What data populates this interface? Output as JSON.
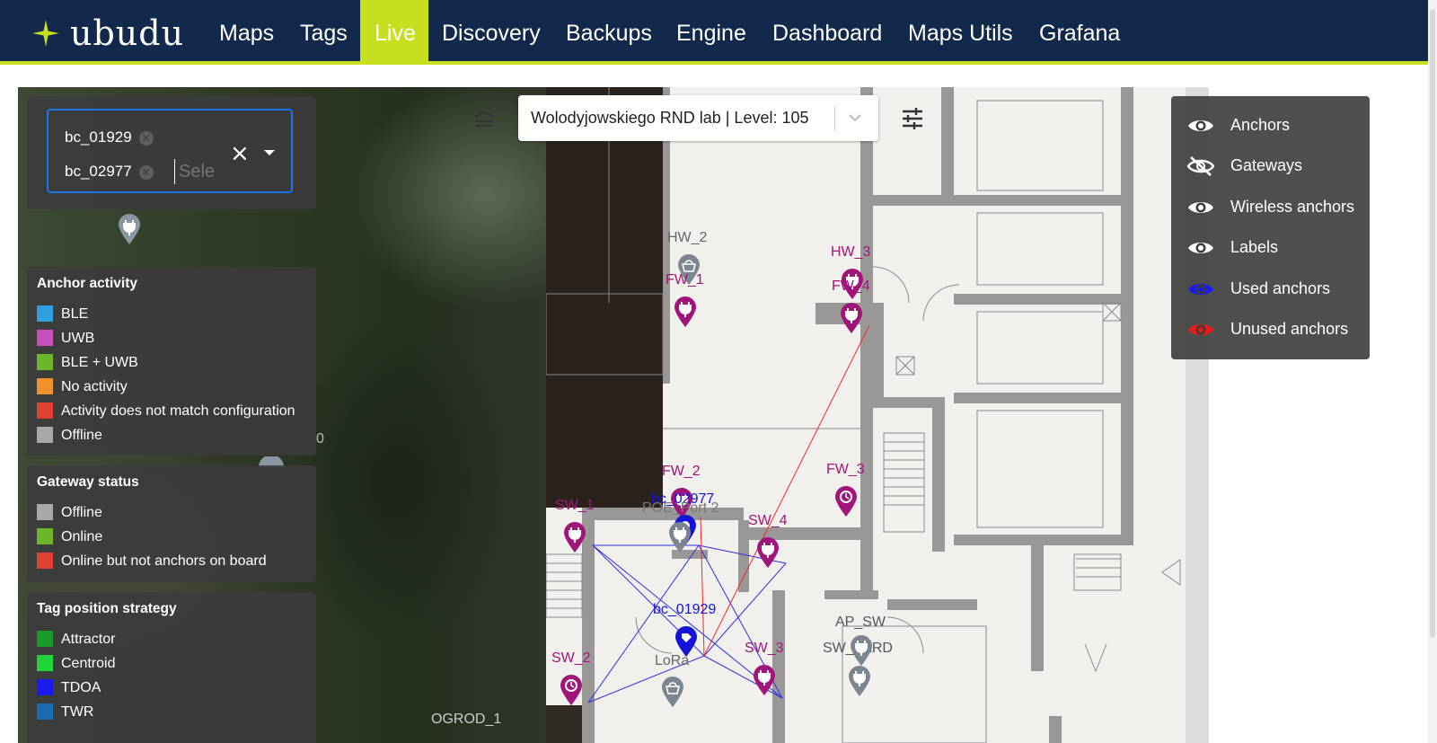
{
  "nav": {
    "brand": "ubudu",
    "items": [
      {
        "label": "Maps",
        "active": false
      },
      {
        "label": "Tags",
        "active": false
      },
      {
        "label": "Live",
        "active": true
      },
      {
        "label": "Discovery",
        "active": false
      },
      {
        "label": "Backups",
        "active": false
      },
      {
        "label": "Engine",
        "active": false
      },
      {
        "label": "Dashboard",
        "active": false
      },
      {
        "label": "Maps Utils",
        "active": false
      },
      {
        "label": "Grafana",
        "active": false
      }
    ],
    "accent": "#c6df1f",
    "background": "#13294b"
  },
  "tag_select": {
    "chips": [
      "bc_01929",
      "bc_02977"
    ],
    "placeholder": "Sele"
  },
  "level_select": {
    "label": "Wolodyjowskiego RND lab | Level: 105"
  },
  "legends": {
    "anchor_activity": {
      "title": "Anchor activity",
      "items": [
        {
          "label": "BLE",
          "color": "#2e9fe0"
        },
        {
          "label": "UWB",
          "color": "#c84fbf"
        },
        {
          "label": "BLE + UWB",
          "color": "#6cb52c"
        },
        {
          "label": "No activity",
          "color": "#f0922c"
        },
        {
          "label": "Activity does not match configuration",
          "color": "#e04030"
        },
        {
          "label": "Offline",
          "color": "#a8a8a8"
        }
      ]
    },
    "gateway_status": {
      "title": "Gateway status",
      "items": [
        {
          "label": "Offline",
          "color": "#a8a8a8"
        },
        {
          "label": "Online",
          "color": "#6cb52c"
        },
        {
          "label": "Online but not anchors on board",
          "color": "#e04030"
        }
      ]
    },
    "tag_position_strategy": {
      "title": "Tag position strategy",
      "items": [
        {
          "label": "Attractor",
          "color": "#1a9a2a"
        },
        {
          "label": "Centroid",
          "color": "#22d43a"
        },
        {
          "label": "TDOA",
          "color": "#1a1aee"
        },
        {
          "label": "TWR",
          "color": "#1a6bb0"
        }
      ]
    }
  },
  "layers": [
    {
      "label": "Anchors",
      "icon": "eye-icon",
      "visible": true,
      "color": "#ffffff"
    },
    {
      "label": "Gateways",
      "icon": "eye-off-icon",
      "visible": false,
      "color": "#ffffff"
    },
    {
      "label": "Wireless anchors",
      "icon": "eye-icon",
      "visible": true,
      "color": "#ffffff"
    },
    {
      "label": "Labels",
      "icon": "eye-icon",
      "visible": true,
      "color": "#ffffff"
    },
    {
      "label": "Used anchors",
      "icon": "eye-icon",
      "visible": true,
      "color": "#1a1aee"
    },
    {
      "label": "Unused anchors",
      "icon": "eye-icon",
      "visible": true,
      "color": "#ee1a1a"
    }
  ],
  "map_labels": {
    "hw2": "HW_2",
    "fw1": "FW_1",
    "hw3": "HW_3",
    "fw4": "FW_4",
    "fw2": "FW_2",
    "fw3": "FW_3",
    "bc02977": "bc_02977",
    "port2": "POE_Port 2",
    "sw1": "SW_1",
    "sw4": "SW_4",
    "bc01929": "bc_01929",
    "lora": "LoRa",
    "ap_sw": "AP_SW",
    "sw_yard": "SW_YARD",
    "sw3": "SW_3",
    "sw2": "SW_2",
    "ogrod": "OGROD_1",
    "edge": "0"
  },
  "colors": {
    "anchor_pin": "#a0157a",
    "gateway_pin": "#7b8690",
    "tag_pin": "#1414d8",
    "link_used": "#3030e0",
    "link_unused": "#ee2a2a"
  }
}
